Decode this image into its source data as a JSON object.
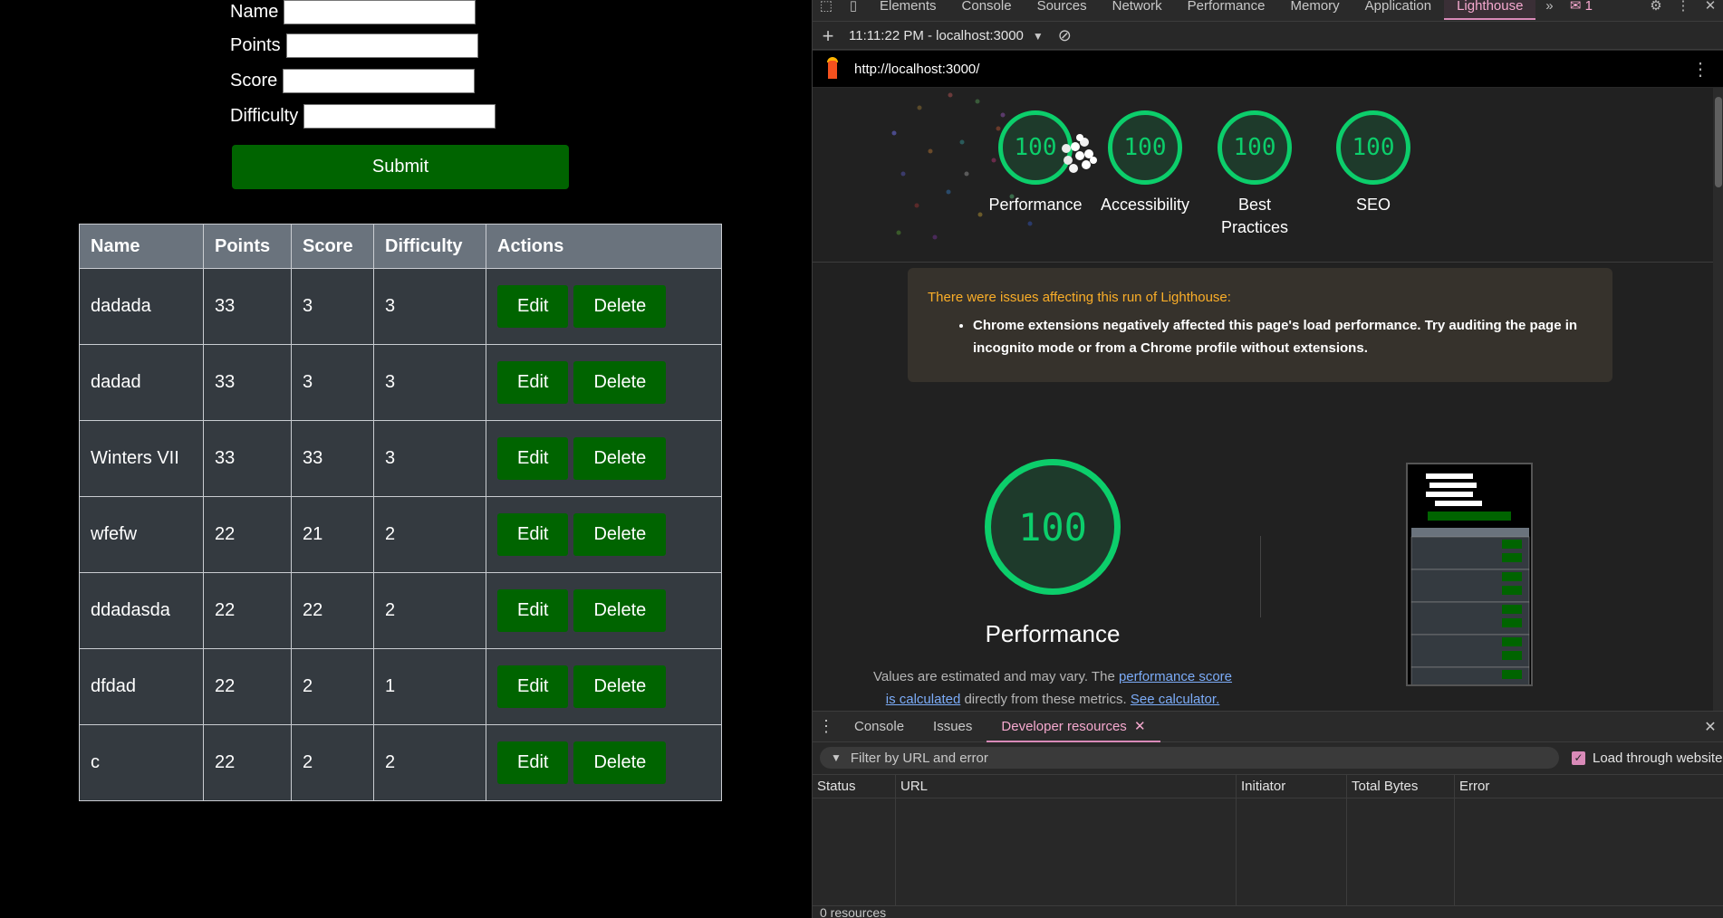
{
  "form": {
    "name_label": "Name",
    "points_label": "Points",
    "score_label": "Score",
    "difficulty_label": "Difficulty",
    "submit_label": "Submit"
  },
  "table": {
    "headers": [
      "Name",
      "Points",
      "Score",
      "Difficulty",
      "Actions"
    ],
    "rows": [
      {
        "name": "dadada",
        "points": "33",
        "score": "3",
        "difficulty": "3"
      },
      {
        "name": "dadad",
        "points": "33",
        "score": "3",
        "difficulty": "3"
      },
      {
        "name": "Winters VII",
        "points": "33",
        "score": "33",
        "difficulty": "3"
      },
      {
        "name": "wfefw",
        "points": "22",
        "score": "21",
        "difficulty": "2"
      },
      {
        "name": "ddadasda",
        "points": "22",
        "score": "22",
        "difficulty": "2"
      },
      {
        "name": "dfdad",
        "points": "22",
        "score": "2",
        "difficulty": "1"
      },
      {
        "name": "c",
        "points": "22",
        "score": "2",
        "difficulty": "2"
      }
    ],
    "edit_label": "Edit",
    "delete_label": "Delete"
  },
  "devtools": {
    "tabs": [
      "Elements",
      "Console",
      "Sources",
      "Network",
      "Performance",
      "Memory",
      "Application",
      "Lighthouse"
    ],
    "active_tab": "Lighthouse",
    "issues_count": "1",
    "accent_color": "#d98ab8"
  },
  "lighthouse": {
    "report_selector": "11:11:22 PM - localhost:3000",
    "url": "http://localhost:3000/",
    "gauges": [
      {
        "label": "Performance",
        "score": "100"
      },
      {
        "label": "Accessibility",
        "score": "100"
      },
      {
        "label": "Best Practices",
        "score": "100"
      },
      {
        "label": "SEO",
        "score": "100"
      }
    ],
    "warning": {
      "title": "There were issues affecting this run of Lighthouse:",
      "item": "Chrome extensions negatively affected this page's load performance. Try auditing the page in incognito mode or from a Chrome profile without extensions."
    },
    "performance": {
      "score": "100",
      "title": "Performance",
      "note_prefix": "Values are estimated and may vary. The ",
      "note_link1": "performance score is calculated",
      "note_middle": " directly from these metrics. ",
      "note_link2": "See calculator."
    },
    "score_color": "#0cce6b"
  },
  "drawer": {
    "tabs": [
      "Console",
      "Issues",
      "Developer resources"
    ],
    "active_tab": "Developer resources",
    "filter_placeholder": "Filter by URL and error",
    "load_through_website": "Load through website",
    "columns": [
      "Status",
      "URL",
      "Initiator",
      "Total Bytes",
      "Error"
    ],
    "footer": "0 resources"
  }
}
